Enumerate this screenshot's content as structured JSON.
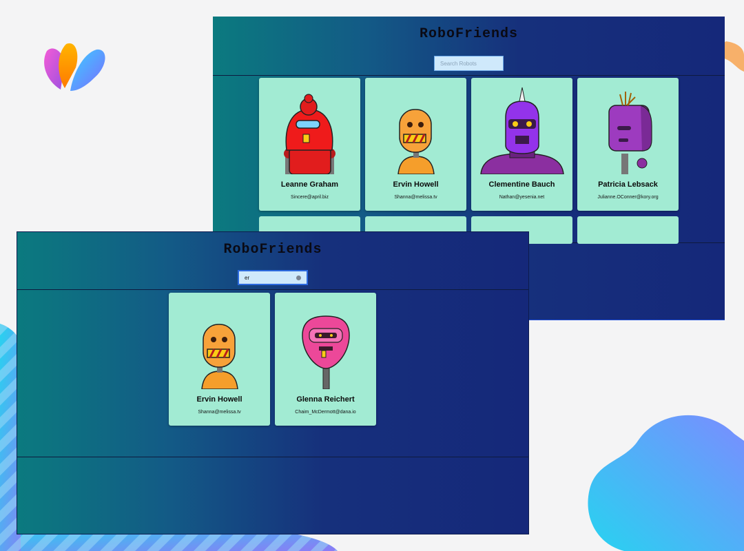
{
  "back_window": {
    "title": "RoboFriends",
    "search_placeholder": "Search Robots",
    "cards": [
      {
        "name": "Leanne Graham",
        "email": "Sincere@april.biz"
      },
      {
        "name": "Ervin Howell",
        "email": "Shanna@melissa.tv"
      },
      {
        "name": "Clementine Bauch",
        "email": "Nathan@yesenia.net"
      },
      {
        "name": "Patricia Lebsack",
        "email": "Julianne.OConner@kory.org"
      }
    ]
  },
  "front_window": {
    "title": "RoboFriends",
    "search_value": "er",
    "cards": [
      {
        "name": "Ervin Howell",
        "email": "Shanna@melissa.tv"
      },
      {
        "name": "Glenna Reichert",
        "email": "Chaim_McDermott@dana.io"
      }
    ]
  },
  "colors": {
    "card_bg": "#a2ebd3",
    "gradient_start": "#0b7a7f",
    "gradient_end": "#15287a"
  }
}
